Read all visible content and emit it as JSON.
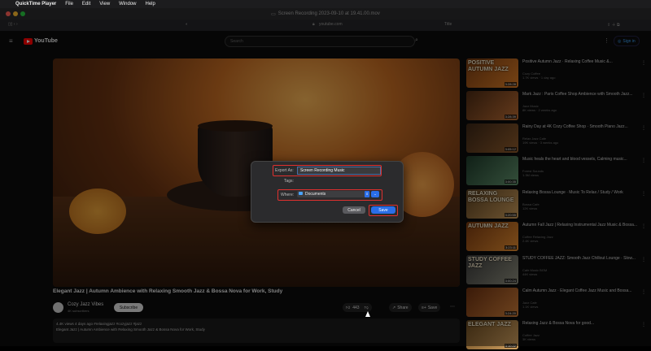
{
  "menubar": {
    "app": "QuickTime Player",
    "items": [
      "File",
      "Edit",
      "View",
      "Window",
      "Help"
    ]
  },
  "window": {
    "title": "Screen Recording 2023-09-10 at 19.41.00.mov"
  },
  "browser": {
    "url": "youtube.com",
    "tab_label": "Title"
  },
  "youtube": {
    "logo": "YouTube",
    "search_placeholder": "Search",
    "signin": "Sign in",
    "video": {
      "title": "Elegant Jazz | Autumn Ambience with Relaxing Smooth Jazz & Bossa Nova for Work, Study",
      "channel": "Cozy Jazz Vibes",
      "subscribers": "4K subscribers",
      "subscribe": "Subscribe",
      "likes": "443",
      "share": "Share",
      "save": "Save",
      "stats": "4.4K views  4 days ago  #relaxingjazz #cozyjazz #jazz",
      "description": "Elegant Jazz | Autumn Ambience with Relaxing Smooth Jazz & Bossa Nova for Work, Study"
    },
    "sidebar": [
      {
        "thumb_text": "POSITIVE AUTUMN JAZZ",
        "duration": "3:28:28",
        "title": "Positive Autumn Jazz · Relaxing Coffee Music &...",
        "channel": "Cozy Coffee",
        "meta": "1.7K views · 1 day ago",
        "colors": [
          "#7a3d12",
          "#d97b26"
        ]
      },
      {
        "thumb_text": "",
        "duration": "3:28:39",
        "title": "Mark Jazz : Paris Coffee Shop Ambience with Smooth Jazz...",
        "channel": "Jazz Music",
        "meta": "8K views · 2 weeks ago",
        "colors": [
          "#4a2a14",
          "#b86a32"
        ]
      },
      {
        "thumb_text": "",
        "duration": "3:05:12",
        "title": "Rainy Day at 4K Cozy Coffee Shop · Smooth Piano Jazz...",
        "channel": "Relax Jazz Cafe",
        "meta": "19K views · 3 weeks ago",
        "colors": [
          "#3b2616",
          "#8d5a2c"
        ]
      },
      {
        "thumb_text": "",
        "duration": "3:00:35",
        "title": "Music heals the heart and blood vessels, Calming music...",
        "channel": "Forest Sounds",
        "meta": "1.3M views",
        "colors": [
          "#1e3a2a",
          "#5f8f6a"
        ]
      },
      {
        "thumb_text": "RELAXING BOSSA LOUNGE",
        "duration": "3:20:55",
        "title": "Relaxing Bossa Lounge · Music To Relax / Study / Work",
        "channel": "Bossa Cafe",
        "meta": "12K views",
        "colors": [
          "#5a4020",
          "#c99a5a"
        ]
      },
      {
        "thumb_text": "AUTUMN JAZZ",
        "duration": "3:23:11",
        "title": "Autumn Fall Jazz | Relaxing Instrumental Jazz Music & Bossa...",
        "channel": "Coffee Relaxing Jazz",
        "meta": "2.4K views",
        "colors": [
          "#7a3a10",
          "#e08a30"
        ]
      },
      {
        "thumb_text": "STUDY COFFEE JAZZ",
        "duration": "3:00:24",
        "title": "STUDY COFFEE JAZZ: Smooth Jazz Chillout Lounge · Slow...",
        "channel": "Cafe Music BGM",
        "meta": "44K views",
        "colors": [
          "#3a3a3a",
          "#8a8a7a"
        ]
      },
      {
        "thumb_text": "",
        "duration": "3:24:20",
        "title": "Calm Autumn Jazz · Elegant Coffee Jazz Music and Bossa...",
        "channel": "Jazz Cafe",
        "meta": "1.1K views",
        "colors": [
          "#6a3010",
          "#c87a38"
        ]
      },
      {
        "thumb_text": "ELEGANT JAZZ",
        "duration": "3:10:22",
        "title": "Relaxing Jazz & Bossa Nova for good...",
        "channel": "Coffee Jazz",
        "meta": "3K views",
        "colors": [
          "#6a4a20",
          "#d0a060"
        ]
      }
    ]
  },
  "dialog": {
    "export_label": "Export As:",
    "export_value": "Screen Recording Music",
    "tags_label": "Tags:",
    "where_label": "Where:",
    "where_value": "Documents",
    "cancel": "Cancel",
    "save": "Save"
  },
  "colors": {
    "accent": "#e0302e",
    "save_button": "#2a6ee8",
    "yt_red": "#ff0000"
  }
}
